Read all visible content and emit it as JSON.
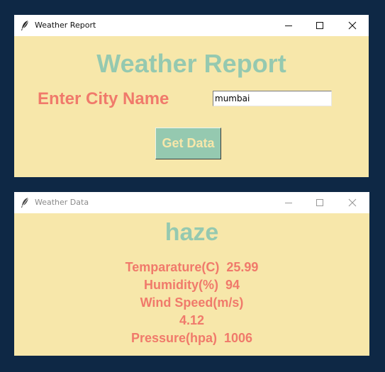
{
  "main_window": {
    "title": "Weather Report",
    "heading": "Weather Report",
    "city_label": "Enter City Name",
    "city_input_value": "mumbai",
    "get_data_label": "Get Data"
  },
  "data_window": {
    "title": "Weather Data",
    "description": "haze",
    "lines": [
      "Temparature(C)  25.99",
      "Humidity(%)  94",
      "Wind Speed(m/s)",
      "4.12",
      "Pressure(hpa)  1006"
    ]
  },
  "colors": {
    "background": "#0e2845",
    "window_bg": "#f7e7aa",
    "accent_green": "#95c9b0",
    "accent_red": "#f07a6b"
  },
  "icons": {
    "app_icon": "feather-icon",
    "minimize": "minimize-icon",
    "maximize": "maximize-icon",
    "close": "close-icon"
  }
}
